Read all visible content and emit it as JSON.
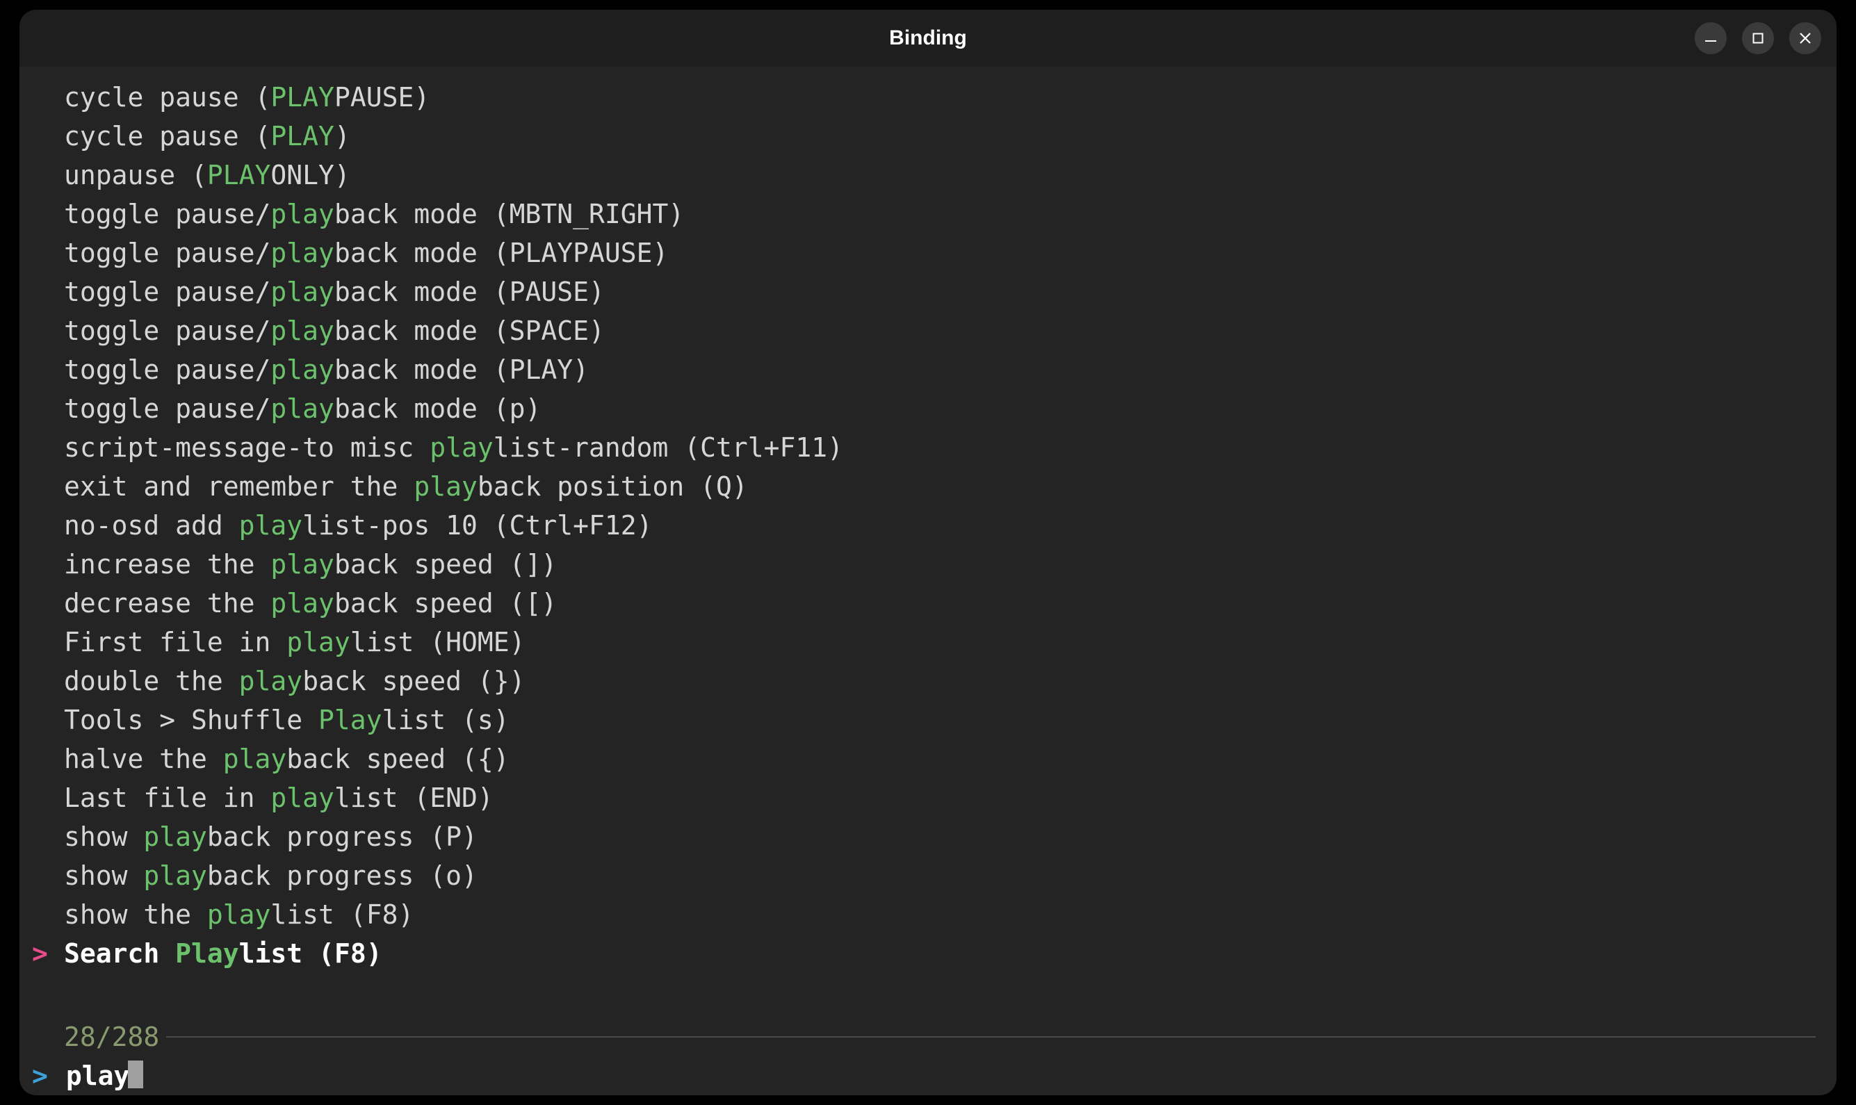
{
  "window": {
    "title": "Binding"
  },
  "search": {
    "query": "play",
    "prompt_marker": ">"
  },
  "status": {
    "count": "28/288"
  },
  "selected_index": 22,
  "results": [
    {
      "segments": [
        {
          "t": "cycle pause ("
        },
        {
          "t": "PLAY",
          "hl": true
        },
        {
          "t": "PAUSE)"
        }
      ]
    },
    {
      "segments": [
        {
          "t": "cycle pause ("
        },
        {
          "t": "PLAY",
          "hl": true
        },
        {
          "t": ")"
        }
      ]
    },
    {
      "segments": [
        {
          "t": "unpause ("
        },
        {
          "t": "PLAY",
          "hl": true
        },
        {
          "t": "ONLY)"
        }
      ]
    },
    {
      "segments": [
        {
          "t": "toggle pause/"
        },
        {
          "t": "play",
          "hl": true
        },
        {
          "t": "back mode (MBTN_RIGHT)"
        }
      ]
    },
    {
      "segments": [
        {
          "t": "toggle pause/"
        },
        {
          "t": "play",
          "hl": true
        },
        {
          "t": "back mode (PLAYPAUSE)"
        }
      ]
    },
    {
      "segments": [
        {
          "t": "toggle pause/"
        },
        {
          "t": "play",
          "hl": true
        },
        {
          "t": "back mode (PAUSE)"
        }
      ]
    },
    {
      "segments": [
        {
          "t": "toggle pause/"
        },
        {
          "t": "play",
          "hl": true
        },
        {
          "t": "back mode (SPACE)"
        }
      ]
    },
    {
      "segments": [
        {
          "t": "toggle pause/"
        },
        {
          "t": "play",
          "hl": true
        },
        {
          "t": "back mode (PLAY)"
        }
      ]
    },
    {
      "segments": [
        {
          "t": "toggle pause/"
        },
        {
          "t": "play",
          "hl": true
        },
        {
          "t": "back mode (p)"
        }
      ]
    },
    {
      "segments": [
        {
          "t": "script-message-to misc "
        },
        {
          "t": "play",
          "hl": true
        },
        {
          "t": "list-random (Ctrl+F11)"
        }
      ]
    },
    {
      "segments": [
        {
          "t": "exit and remember the "
        },
        {
          "t": "play",
          "hl": true
        },
        {
          "t": "back position (Q)"
        }
      ]
    },
    {
      "segments": [
        {
          "t": "no-osd add "
        },
        {
          "t": "play",
          "hl": true
        },
        {
          "t": "list-pos 10 (Ctrl+F12)"
        }
      ]
    },
    {
      "segments": [
        {
          "t": "increase the "
        },
        {
          "t": "play",
          "hl": true
        },
        {
          "t": "back speed (])"
        }
      ]
    },
    {
      "segments": [
        {
          "t": "decrease the "
        },
        {
          "t": "play",
          "hl": true
        },
        {
          "t": "back speed ([)"
        }
      ]
    },
    {
      "segments": [
        {
          "t": "First file in "
        },
        {
          "t": "play",
          "hl": true
        },
        {
          "t": "list (HOME)"
        }
      ]
    },
    {
      "segments": [
        {
          "t": "double the "
        },
        {
          "t": "play",
          "hl": true
        },
        {
          "t": "back speed (})"
        }
      ]
    },
    {
      "segments": [
        {
          "t": "Tools > Shuffle "
        },
        {
          "t": "Play",
          "hl": true
        },
        {
          "t": "list (s)"
        }
      ]
    },
    {
      "segments": [
        {
          "t": "halve the "
        },
        {
          "t": "play",
          "hl": true
        },
        {
          "t": "back speed ({)"
        }
      ]
    },
    {
      "segments": [
        {
          "t": "Last file in "
        },
        {
          "t": "play",
          "hl": true
        },
        {
          "t": "list (END)"
        }
      ]
    },
    {
      "segments": [
        {
          "t": "show "
        },
        {
          "t": "play",
          "hl": true
        },
        {
          "t": "back progress (P)"
        }
      ]
    },
    {
      "segments": [
        {
          "t": "show "
        },
        {
          "t": "play",
          "hl": true
        },
        {
          "t": "back progress (o)"
        }
      ]
    },
    {
      "segments": [
        {
          "t": "show the "
        },
        {
          "t": "play",
          "hl": true
        },
        {
          "t": "list (F8)"
        }
      ]
    },
    {
      "segments": [
        {
          "t": "Search "
        },
        {
          "t": "Play",
          "hl": true
        },
        {
          "t": "list (F8)"
        }
      ]
    }
  ]
}
